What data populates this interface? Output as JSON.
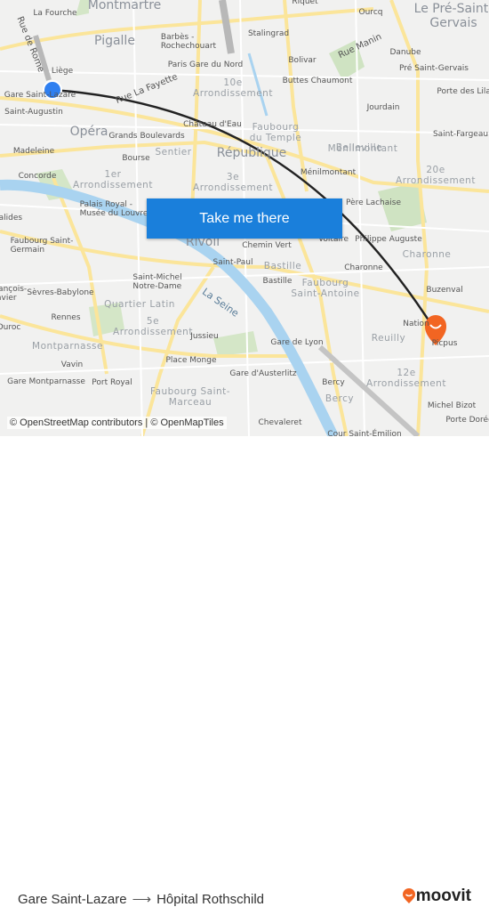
{
  "map": {
    "labels": [
      "Montmartre",
      "La Fourche",
      "Rue de Rome",
      "Pigalle",
      "Barbès -\nRochechouart",
      "Paris Gare du Nord",
      "Liège",
      "Gare Saint-Lazare",
      "Saint-Augustin",
      "Rue La Fayette",
      "10e\nArrondissement",
      "Château d'Eau",
      "Opéra",
      "Grands Boulevards",
      "Madeleine",
      "Bourse",
      "Sentier",
      "Concorde",
      "1er\nArrondissement",
      "Palais Royal -\nMusée du Louvre",
      "Faubourg Saint-\nGermain",
      "Rivoli",
      "Saint-Paul",
      "Chemin Vert",
      "3e\nArrondissement",
      "République",
      "Faubourg\ndu Temple",
      "Belleville",
      "Ménilmontant",
      "Ménilmontant",
      "20e\nArrondissement",
      "Père Lachaise",
      "Philippe Auguste",
      "Voltaire",
      "Charonne",
      "Charonne",
      "Bastille",
      "Bastille",
      "Faubourg\nSaint-Antoine",
      "Buzenval",
      "Nation",
      "Picpus",
      "Reuilly",
      "Saint-Michel\nNotre-Dame",
      "Quartier Latin",
      "Sèvres-Babylone",
      "Rennes",
      "5e\nArrondissement",
      "Jussieu",
      "Montparnasse",
      "Vavin",
      "Gare Montparnasse",
      "Port Royal",
      "Place Monge",
      "Gare de Lyon",
      "Gare d'Austerlitz",
      "Faubourg Saint-\nMarceau",
      "La Seine",
      "Bercy",
      "Bercy",
      "12e\nArrondissement",
      "Michel Bizot",
      "Porte Dorée",
      "Cour Saint-Émilion",
      "Chevaleret",
      "Stalingrad",
      "Riquet",
      "Ourcq",
      "Rue Manin",
      "Bolivar",
      "Buttes Chaumont",
      "Danube",
      "Pré Saint-Gervais",
      "Le Pré-Saint-\nGervais",
      "Porte des Lilas",
      "Jourdain",
      "Saint-Fargeau",
      "Duroc",
      "François-\nXavier",
      "Invalides"
    ],
    "origin_color": "#2f7ff0",
    "destination_color": "#f26522",
    "route_color": "#222222"
  },
  "cta": {
    "label": "Take me there"
  },
  "attribution": "© OpenStreetMap contributors | © OpenMapTiles",
  "footer": {
    "origin": "Gare Saint-Lazare",
    "arrow": "⟶",
    "destination": "Hôpital Rothschild",
    "brand": "moovit",
    "brand_color": "#f26522"
  }
}
